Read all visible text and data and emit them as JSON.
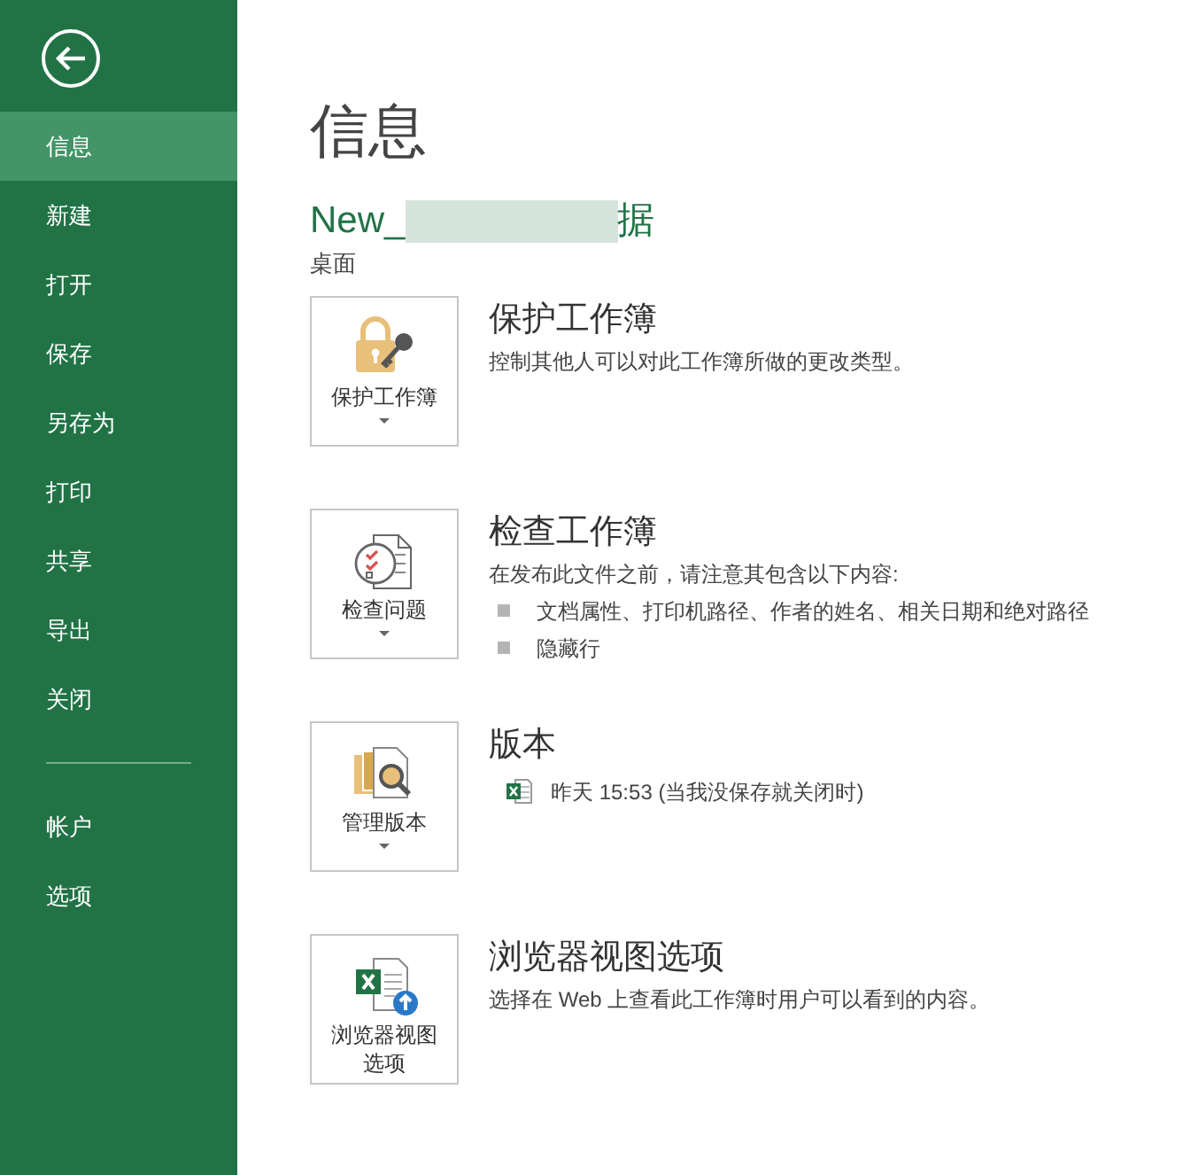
{
  "sidebar": {
    "items": [
      {
        "label": "信息",
        "selected": true
      },
      {
        "label": "新建",
        "selected": false
      },
      {
        "label": "打开",
        "selected": false
      },
      {
        "label": "保存",
        "selected": false
      },
      {
        "label": "另存为",
        "selected": false
      },
      {
        "label": "打印",
        "selected": false
      },
      {
        "label": "共享",
        "selected": false
      },
      {
        "label": "导出",
        "selected": false
      },
      {
        "label": "关闭",
        "selected": false
      }
    ],
    "bottom_items": [
      {
        "label": "帐户",
        "selected": false
      },
      {
        "label": "选项",
        "selected": false
      }
    ]
  },
  "page_title": "信息",
  "file": {
    "name_start": "New_",
    "name_end": "据",
    "location": "桌面"
  },
  "sections": [
    {
      "kind": "protect",
      "button_label": "保护工作簿",
      "dropdown": true,
      "heading": "保护工作簿",
      "description": "控制其他人可以对此工作簿所做的更改类型。"
    },
    {
      "kind": "inspect",
      "button_label": "检查问题",
      "dropdown": true,
      "heading": "检查工作簿",
      "description": "在发布此文件之前，请注意其包含以下内容:",
      "bullets": [
        "文档属性、打印机路径、作者的姓名、相关日期和绝对路径",
        "隐藏行"
      ]
    },
    {
      "kind": "versions",
      "button_label": "管理版本",
      "dropdown": true,
      "heading": "版本",
      "versions": [
        "昨天 15:53 (当我没保存就关闭时)"
      ]
    },
    {
      "kind": "browser",
      "button_label": "浏览器视图选项",
      "dropdown": false,
      "heading": "浏览器视图选项",
      "description": "选择在 Web 上查看此工作簿时用户可以看到的内容。"
    }
  ]
}
